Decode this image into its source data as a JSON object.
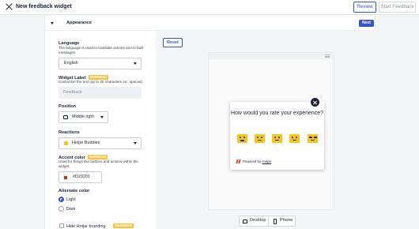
{
  "header": {
    "title": "New feedback widget",
    "review_label": "Review",
    "start_label": "Start Feedback"
  },
  "section": {
    "title": "Appearance",
    "next_label": "Next"
  },
  "form": {
    "language": {
      "label": "Language",
      "help": "The language is used to translate actions and in-built messages.",
      "value": "English"
    },
    "widget_label": {
      "label": "Widget Label",
      "badge": "BUSINESS",
      "help": "Customize the text (up to 20 characters inc. spaces)",
      "placeholder": "Feedback"
    },
    "position": {
      "label": "Position",
      "value": "Middle right"
    },
    "reactions": {
      "label": "Reactions",
      "value": "Hotjar Buddies"
    },
    "accent_color": {
      "label": "Accent color",
      "badge": "BUSINESS",
      "help": "Used for things like buttons and actions within the widget.",
      "value": "#D23201",
      "swatch": "#D23201"
    },
    "alternate_color": {
      "label": "Alternate color",
      "options": [
        "Light",
        "Dark"
      ],
      "selected": "Light"
    },
    "branding": {
      "label": "Hide Hotjar branding",
      "badge": "BUSINESS",
      "checked": false
    }
  },
  "preview": {
    "reset_label": "Reset",
    "question": "How would you rate your experience?",
    "powered_prefix": "Powered by",
    "powered_brand": "Hotjar",
    "devices": [
      "Desktop",
      "Phone"
    ],
    "face_color": "#f5c518"
  },
  "colors": {
    "accent": "#3a56c4",
    "badge": "#f6c23e"
  }
}
